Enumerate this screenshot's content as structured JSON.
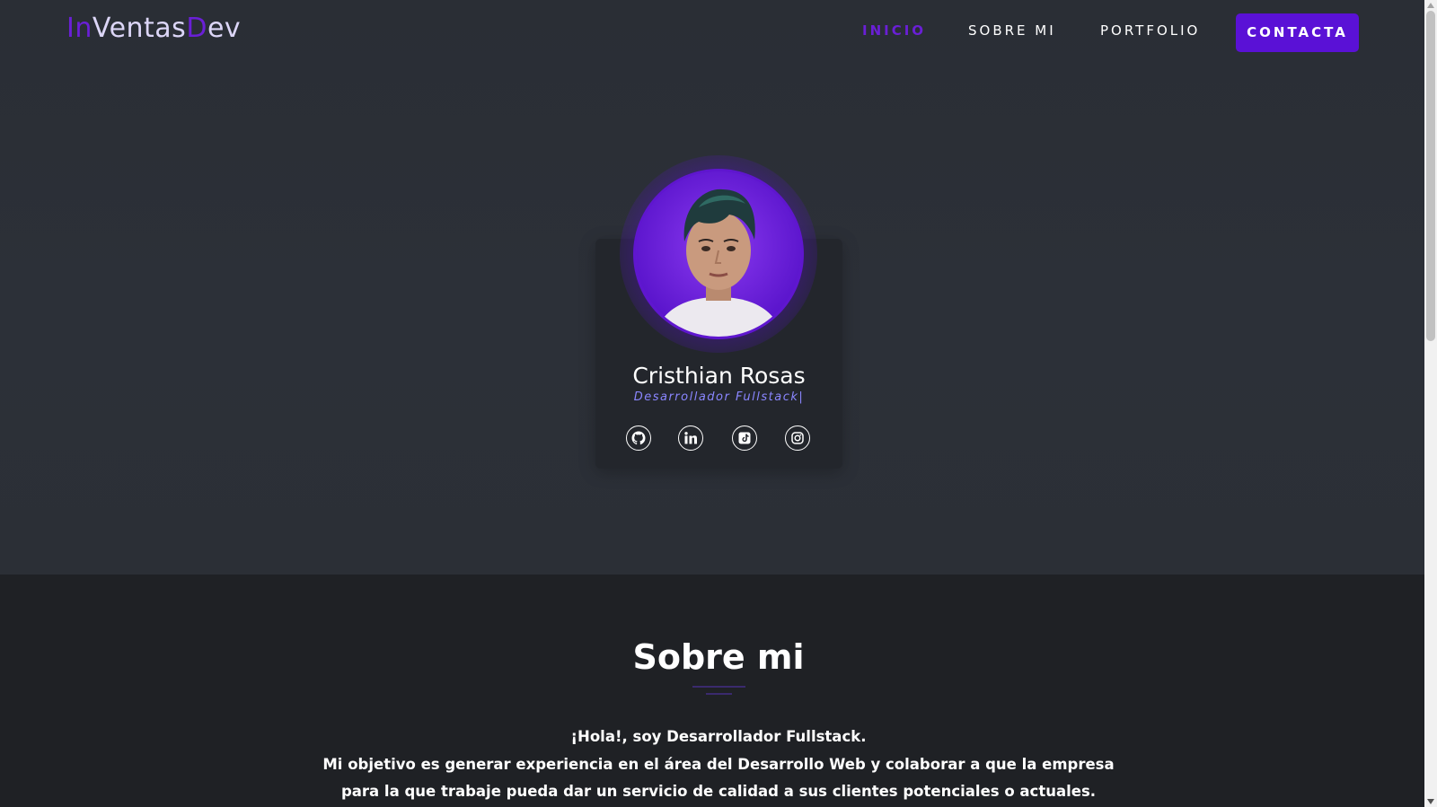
{
  "brand": {
    "part1": "In",
    "part2": "Ventas",
    "part3": "D",
    "part4": "ev"
  },
  "nav": {
    "links": [
      {
        "label": "INICIO",
        "active": true
      },
      {
        "label": "SOBRE MI",
        "active": false
      },
      {
        "label": "PORTFOLIO",
        "active": false
      }
    ],
    "cta_label": "CONTACTA"
  },
  "profile": {
    "name": "Cristhian Rosas",
    "role": "Desarrollador Fullstack|",
    "social": [
      {
        "icon": "github-icon"
      },
      {
        "icon": "linkedin-icon"
      },
      {
        "icon": "tiktok-icon"
      },
      {
        "icon": "instagram-icon"
      }
    ]
  },
  "about": {
    "title": "Sobre mi",
    "lines": [
      "¡Hola!, soy Desarrollador Fullstack.",
      "Mi objetivo es generar experiencia en el área del Desarrollo Web y colaborar a que la empresa",
      "para la que trabaje pueda dar un servicio de calidad a sus clientes potenciales o actuales."
    ]
  },
  "colors": {
    "accent": "#5a11d6",
    "background": "#2a2e35",
    "section_background": "#1f2125"
  }
}
